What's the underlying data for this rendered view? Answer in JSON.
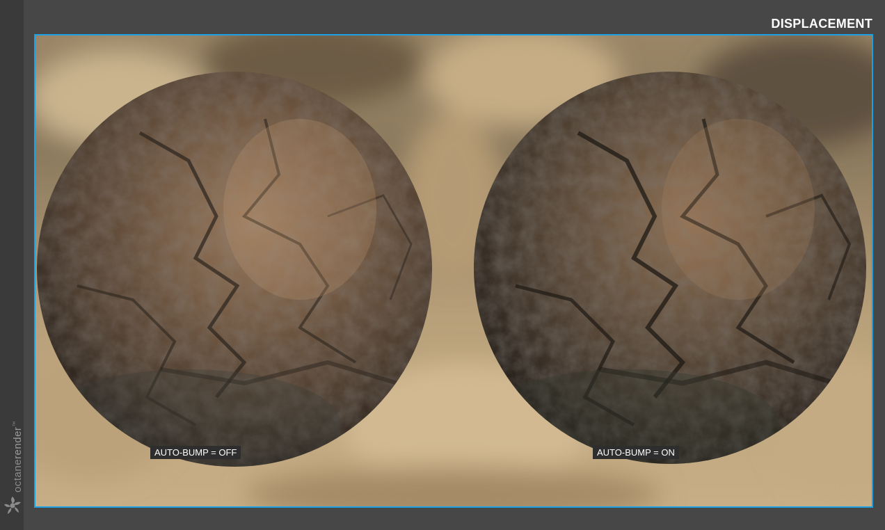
{
  "header": {
    "title": "DISPLACEMENT"
  },
  "brand": {
    "text_main": "octane",
    "text_light": "render",
    "trademark": "™"
  },
  "render": {
    "left_caption": "AUTO-BUMP = OFF",
    "right_caption": "AUTO-BUMP = ON"
  },
  "colors": {
    "frame_border": "#1ca0e6",
    "background": "#474747",
    "sidebar": "#3a3a3a",
    "caption_bg": "#2e2e2e"
  }
}
